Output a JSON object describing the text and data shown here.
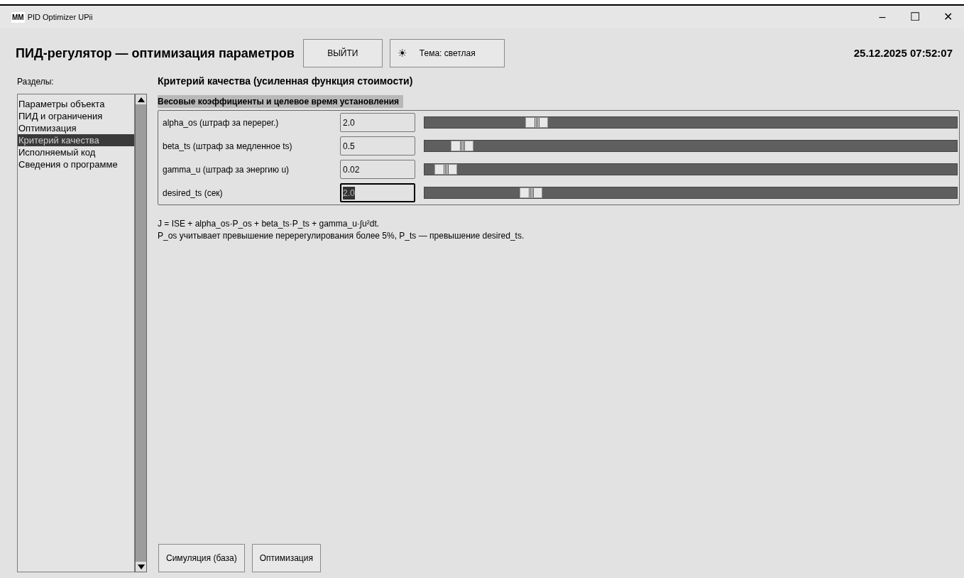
{
  "window": {
    "logo": "MM",
    "title": "PID Optimizer UPii",
    "controls": [
      "–",
      "☐",
      "✕"
    ]
  },
  "header": {
    "title": "ПИД-регулятор — оптимизация параметров",
    "exit_button": "ВЫЙТИ",
    "theme_icon": "☀",
    "theme_button": "Тема: светлая",
    "datetime": "25.12.2025 07:52:07"
  },
  "sidebar": {
    "label": "Разделы:",
    "items": [
      {
        "label": "Параметры объекта",
        "selected": false
      },
      {
        "label": "ПИД и ограничения",
        "selected": false
      },
      {
        "label": "Оптимизация",
        "selected": false
      },
      {
        "label": "Критерий качества",
        "selected": true
      },
      {
        "label": "Исполняемый код",
        "selected": false
      },
      {
        "label": "Сведения о программе",
        "selected": false
      }
    ]
  },
  "content": {
    "title": "Критерий качества (усиленная функция стоимости)",
    "group_title": "Весовые коэффициенты и целевое время установления",
    "params": [
      {
        "label": "alpha_os (штраф за перерег.)",
        "value": "2.0",
        "focused": false,
        "level": 0.21
      },
      {
        "label": "beta_ts (штраф за медленное ts)",
        "value": "0.5",
        "focused": false,
        "level": 0.07
      },
      {
        "label": "gamma_u (штраф за энергию u)",
        "value": "0.02",
        "focused": false,
        "level": 0.04
      },
      {
        "label": "desired_ts (сек)",
        "value": "2.0",
        "focused": true,
        "level": 0.2
      }
    ],
    "notes": [
      "J = ISE + alpha_os·P_os + beta_ts·P_ts + gamma_u·∫u²dt.",
      "P_os учитывает превышение перерегулирования более 5%, P_ts — превышение desired_ts."
    ],
    "buttons": [
      "Симуляция (база)",
      "Оптимизация"
    ]
  }
}
